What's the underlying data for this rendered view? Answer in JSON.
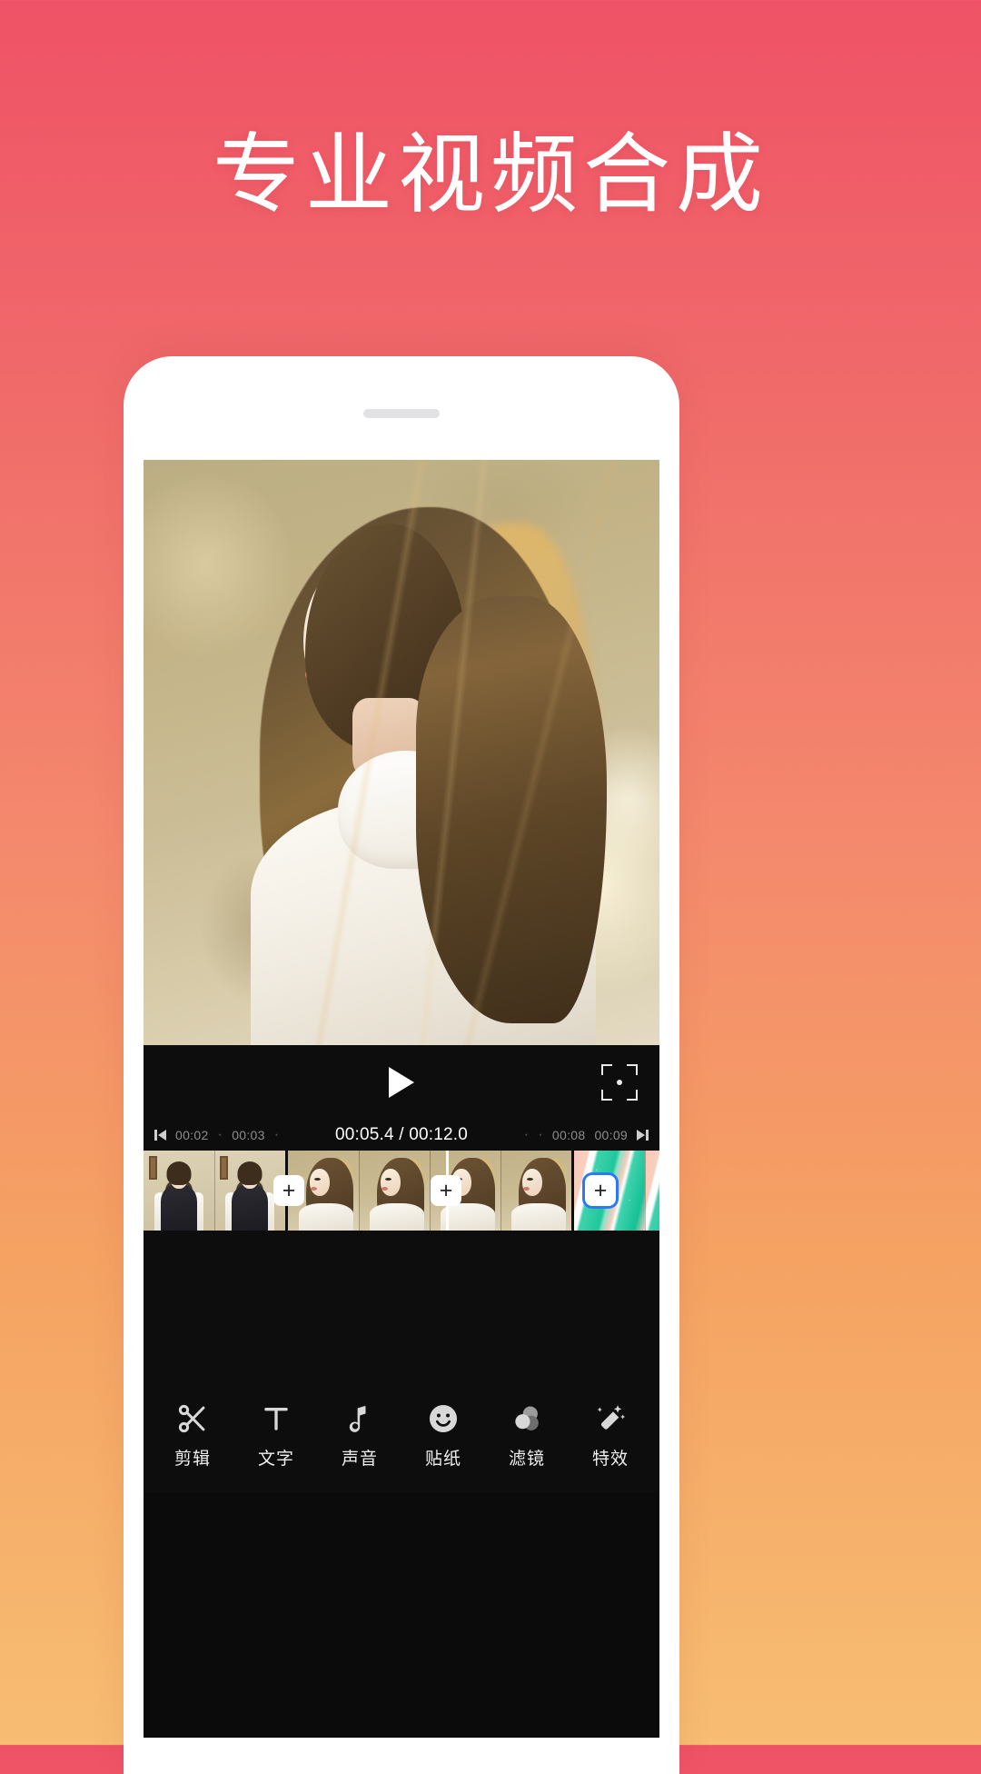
{
  "headline": "专业视频合成",
  "theme": {
    "bg_top": "#ef5266",
    "bg_bottom": "#f7bd72",
    "screen_bg": "#0d0d0d",
    "accent_blue": "#2b79f5",
    "text_white": "#ffffff"
  },
  "phone": {
    "speaker_label": "speaker-grill"
  },
  "player": {
    "play_label": "play-icon",
    "crop_label": "crop-icon"
  },
  "ruler": {
    "prev_icon": "skip-previous-icon",
    "next_icon": "skip-next-icon",
    "left_ticks": [
      {
        "label": "00:02"
      },
      {
        "label": "·"
      },
      {
        "label": "00:03"
      },
      {
        "label": "·"
      }
    ],
    "right_ticks": [
      {
        "label": "·"
      },
      {
        "label": "·"
      },
      {
        "label": "00:08"
      },
      {
        "label": "00:09"
      }
    ],
    "current_time": "00:05.4",
    "separator": "/",
    "total_time": "00:12.0",
    "current_display": "00:05.4 / 00:12.0"
  },
  "timeline": {
    "clips": [
      {
        "name": "clip-indoor-portrait",
        "frames": 2,
        "thumb": "thA"
      },
      {
        "name": "clip-outdoor-portrait",
        "frames": 4,
        "thumb": "thB"
      },
      {
        "name": "clip-abstract-green",
        "frames": 2,
        "thumb": "thC"
      }
    ],
    "transitions": [
      {
        "label": "+",
        "active": false
      },
      {
        "label": "+",
        "active": false
      },
      {
        "label": "+",
        "active": true
      }
    ],
    "playhead_label": "playhead"
  },
  "toolbar": {
    "items": [
      {
        "label": "剪辑",
        "icon": "scissors-icon"
      },
      {
        "label": "文字",
        "icon": "text-icon"
      },
      {
        "label": "声音",
        "icon": "music-note-icon"
      },
      {
        "label": "贴纸",
        "icon": "sticker-smiley-icon"
      },
      {
        "label": "滤镜",
        "icon": "filter-circles-icon"
      },
      {
        "label": "特效",
        "icon": "magic-wand-icon"
      }
    ]
  }
}
